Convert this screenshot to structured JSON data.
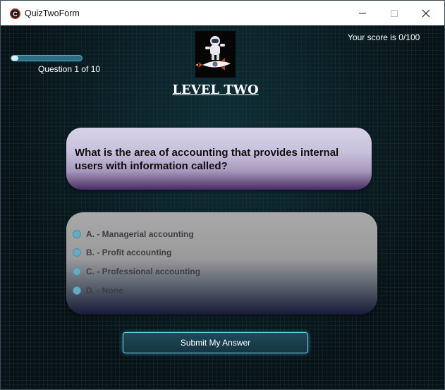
{
  "window": {
    "title": "QuizTwoForm",
    "app_icon": "C",
    "controls": {
      "minimize": "minimize-icon",
      "maximize": "maximize-icon",
      "close": "close-icon"
    }
  },
  "quiz": {
    "progress": {
      "current": 1,
      "total": 10,
      "fraction": 0.1
    },
    "question_counter": "Question 1 of 10",
    "score_text": "Your score is 0/100",
    "level_title": "LEVEL TWO",
    "question": "What is the area of accounting that provides internal users with information called?",
    "options": [
      {
        "label": "A. - Managerial accounting"
      },
      {
        "label": "B. - Profit accounting"
      },
      {
        "label": "C. - Professional accounting"
      },
      {
        "label": "D. - None"
      }
    ],
    "submit_label": "Submit My Answer"
  },
  "colors": {
    "accent_glow": "#6fd2ee",
    "question_box_top": "#d7d2e8",
    "question_box_bottom": "#4a2c66",
    "background": "#081216"
  }
}
